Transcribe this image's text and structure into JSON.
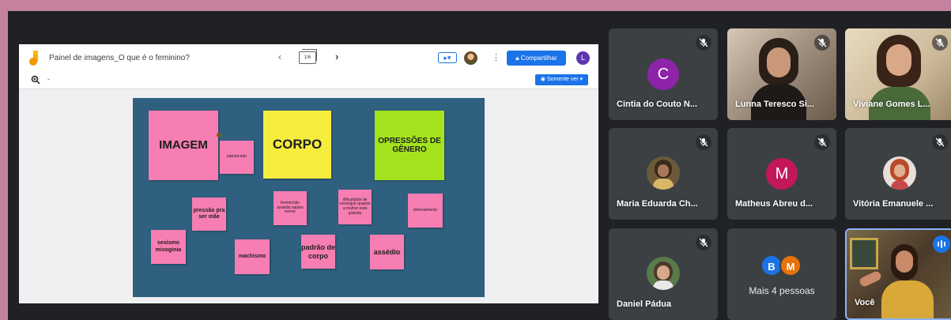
{
  "jamboard": {
    "title": "Painel de imagens_O que é o feminino?",
    "frame_counter": "1/6",
    "share_label": "Compartilhar",
    "account_initial": "L",
    "zoom_dropdown": "-",
    "view_only_label": "Somente ver"
  },
  "board": {
    "notes": {
      "imagem": "IMAGEM",
      "corpo": "CORPO",
      "opressoes": "OPRESSÕES DE GÊNERO",
      "patriarcado": "patriarcado",
      "pressao": "pressão pra ser mãe",
      "feminicidio": "feminicídio assédio salário menor",
      "dificuldade": "dificuldade de conseguir quando a mulher está grávida",
      "silenciamento": "silenciamento",
      "sexismo": "sexismo misoginia",
      "machismo": "machismo",
      "padrao": "padrão de corpo",
      "assedio": "assédio"
    }
  },
  "participants": [
    {
      "name": "Cintia do Couto N...",
      "initial": "C",
      "avatar_color": "#8e24aa",
      "muted": true
    },
    {
      "name": "Lunna Teresco Si...",
      "muted": true,
      "video": true
    },
    {
      "name": "Viviane Gomes L...",
      "muted": true,
      "video": true
    },
    {
      "name": "Maria Eduarda Ch...",
      "muted": true
    },
    {
      "name": "Matheus Abreu d...",
      "initial": "M",
      "avatar_color": "#c2185b",
      "muted": true
    },
    {
      "name": "Vitória Emanuele ...",
      "muted": true
    },
    {
      "name": "Daniel Pádua",
      "muted": true
    },
    {
      "name": "Mais 4 pessoas",
      "extra_initials": [
        "B",
        "M"
      ],
      "extra_colors": [
        "#1a73e8",
        "#e8710a"
      ]
    },
    {
      "name": "Você",
      "speaking": true,
      "video": true
    }
  ],
  "colors": {
    "meet_bg": "#202124",
    "tile_bg": "#3c4043",
    "board_bg": "#2f607f",
    "note_pink": "#f67eb3",
    "note_yellow": "#f6ec3e",
    "note_green": "#a4e21d",
    "accent_blue": "#1a73e8"
  }
}
